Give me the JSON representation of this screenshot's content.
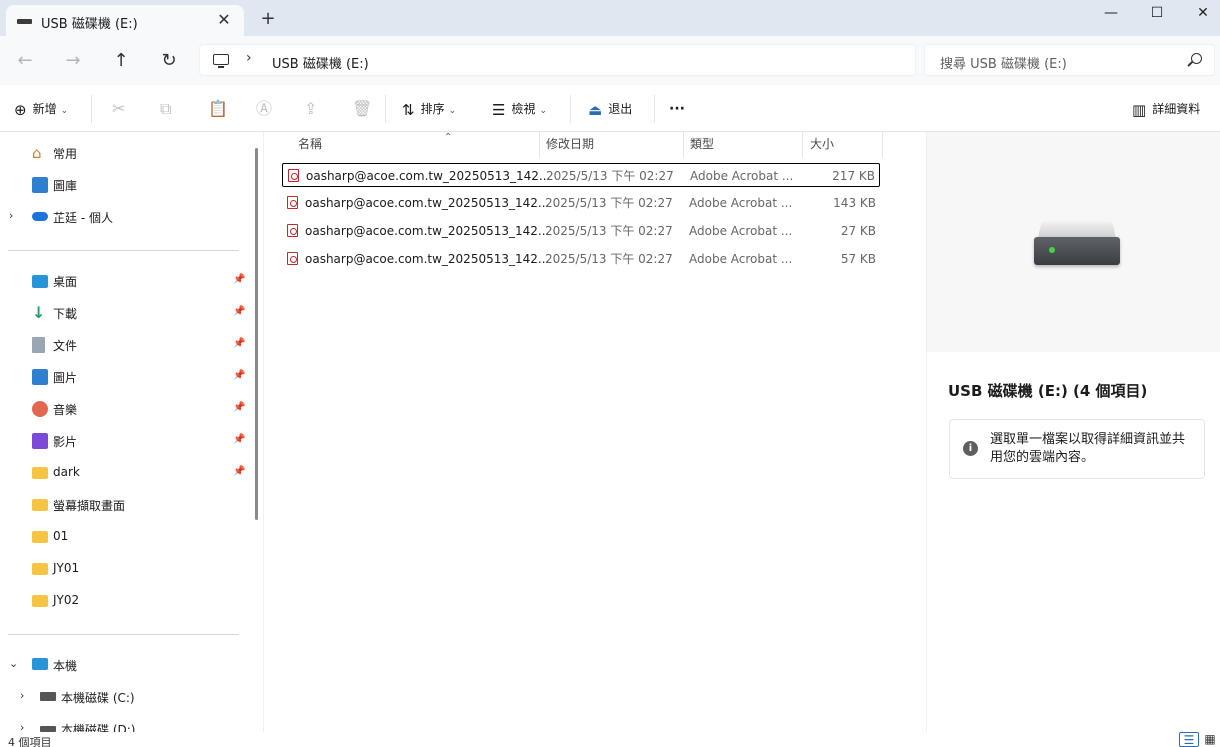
{
  "tab": {
    "title": "USB 磁碟機 (E:)",
    "close": "✕",
    "new_tab": "+"
  },
  "window": {
    "minimize": "—",
    "maximize": "☐",
    "close": "✕"
  },
  "nav": {
    "back": "←",
    "forward": "→",
    "up": "↑",
    "refresh": "↻"
  },
  "address": {
    "separator": "›",
    "path": "USB 磁碟機 (E:)"
  },
  "search": {
    "placeholder": "搜尋 USB 磁碟機 (E:)"
  },
  "toolbar": {
    "new_label": "新增",
    "sort_label": "排序",
    "view_label": "檢視",
    "eject_label": "退出",
    "more_label": "···",
    "details_label": "詳細資料",
    "caret": "⌄"
  },
  "sidebar": {
    "items": [
      {
        "label": "常用",
        "icon": "home-icon",
        "pinned": false
      },
      {
        "label": "圖庫",
        "icon": "gallery-icon",
        "pinned": false
      },
      {
        "label": "芷廷 - 個人",
        "icon": "onedrive-icon",
        "pinned": false,
        "expand": "›"
      },
      {
        "label": "桌面",
        "icon": "desktop-icon",
        "pinned": true
      },
      {
        "label": "下載",
        "icon": "download-icon",
        "pinned": true
      },
      {
        "label": "文件",
        "icon": "document-icon",
        "pinned": true
      },
      {
        "label": "圖片",
        "icon": "picture-icon",
        "pinned": true
      },
      {
        "label": "音樂",
        "icon": "music-icon",
        "pinned": true
      },
      {
        "label": "影片",
        "icon": "video-icon",
        "pinned": true
      },
      {
        "label": "dark",
        "icon": "folder-icon",
        "pinned": true
      },
      {
        "label": "螢幕擷取畫面",
        "icon": "folder-icon",
        "pinned": false
      },
      {
        "label": "01",
        "icon": "folder-icon",
        "pinned": false
      },
      {
        "label": "JY01",
        "icon": "folder-icon",
        "pinned": false
      },
      {
        "label": "JY02",
        "icon": "folder-icon",
        "pinned": false
      },
      {
        "label": "本機",
        "icon": "this-pc-icon",
        "pinned": false,
        "expand": "⌄"
      },
      {
        "label": "本機磁碟 (C:)",
        "icon": "windows-drive-icon",
        "pinned": false,
        "expand": "›"
      },
      {
        "label": "本機磁碟 (D:)",
        "icon": "drive-icon",
        "pinned": false,
        "expand": "›"
      }
    ],
    "pin_glyph": "📌"
  },
  "columns": {
    "name": "名稱",
    "modified": "修改日期",
    "type": "類型",
    "size": "大小",
    "sort_caret": "⌃"
  },
  "files": [
    {
      "name": "oasharp@acoe.com.tw_20250513_142...",
      "modified": "2025/5/13 下午 02:27",
      "type": "Adobe Acrobat ...",
      "size": "217 KB"
    },
    {
      "name": "oasharp@acoe.com.tw_20250513_142...",
      "modified": "2025/5/13 下午 02:27",
      "type": "Adobe Acrobat ...",
      "size": "143 KB"
    },
    {
      "name": "oasharp@acoe.com.tw_20250513_142...",
      "modified": "2025/5/13 下午 02:27",
      "type": "Adobe Acrobat ...",
      "size": "27 KB"
    },
    {
      "name": "oasharp@acoe.com.tw_20250513_142...",
      "modified": "2025/5/13 下午 02:27",
      "type": "Adobe Acrobat ...",
      "size": "57 KB"
    }
  ],
  "details": {
    "title": "USB 磁碟機 (E:) (4 個項目)",
    "info_icon": "i",
    "info_text": "選取單一檔案以取得詳細資訊並共用您的雲端內容。"
  },
  "status": {
    "item_count": "4 個項目",
    "details_view": "☰",
    "tiles_view": "▦"
  }
}
